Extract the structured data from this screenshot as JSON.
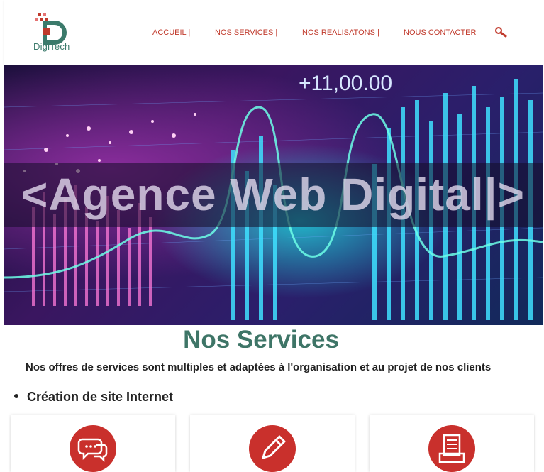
{
  "brand": {
    "logo_text": "DigiTech"
  },
  "nav": {
    "items": [
      "ACCUEIL |",
      "NOS SERVICES |",
      "NOS REALISATONS |",
      "NOUS CONTACTER"
    ]
  },
  "hero": {
    "title": "<Agence Web Digital|>",
    "ticker": "+11,00.00"
  },
  "services": {
    "title": "Nos Services",
    "subtitle": "Nos offres de services sont multiples et adaptées à l'organisation et au projet de nos clients",
    "bullet": "Création de site Internet"
  },
  "colors": {
    "accent": "#c0392b",
    "brand_green": "#3e7567",
    "icon_red": "#c9302c"
  },
  "icons": [
    "chat-bubbles-icon",
    "pencil-icon",
    "document-printer-icon"
  ]
}
